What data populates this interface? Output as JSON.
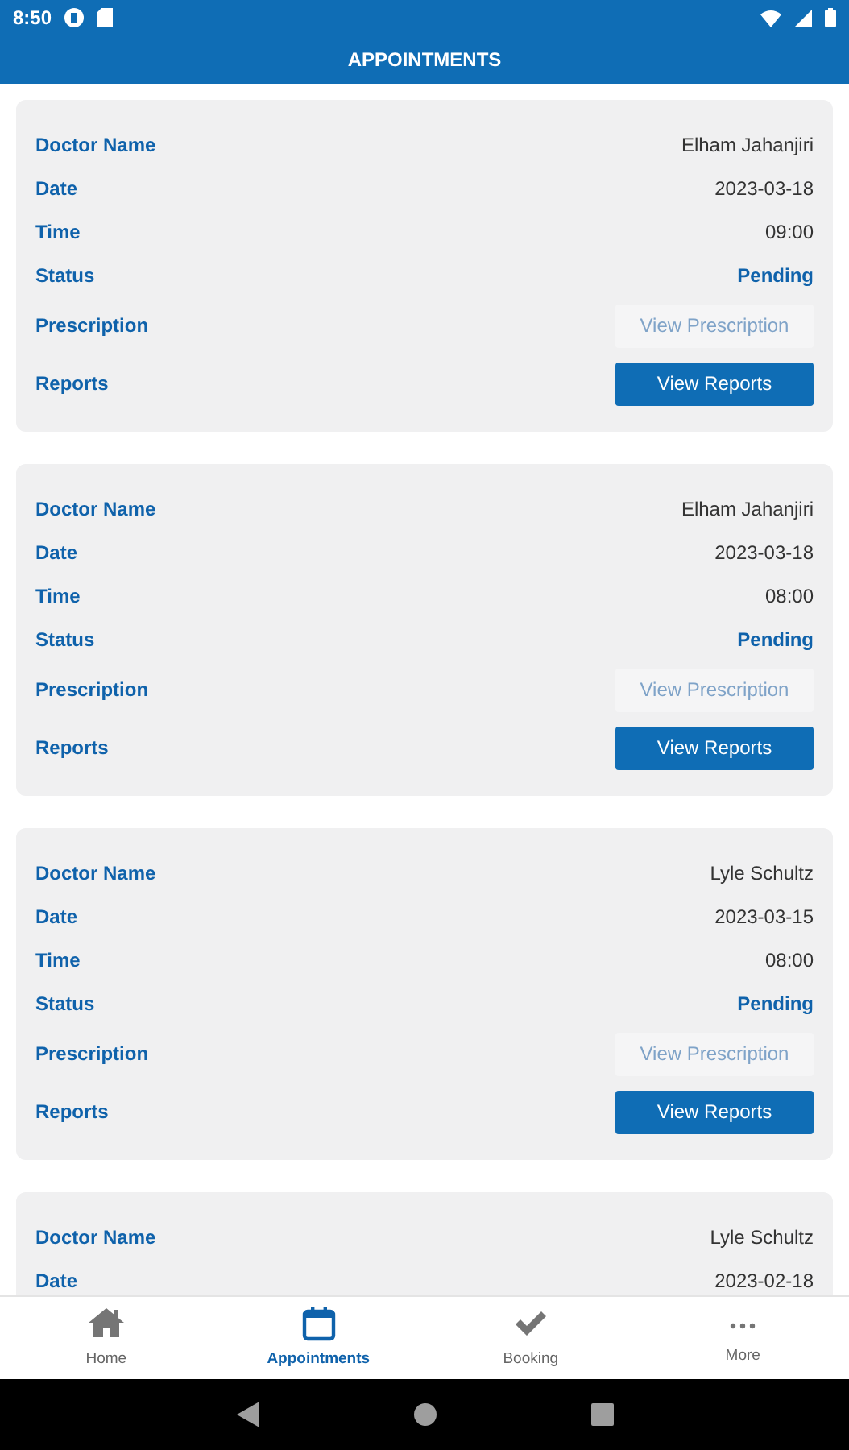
{
  "status_bar": {
    "time": "8:50"
  },
  "header": {
    "title": "APPOINTMENTS"
  },
  "appointments": [
    {
      "fields": [
        {
          "label": "Doctor Name",
          "kind": "text",
          "value": "Elham Jahanjiri"
        },
        {
          "label": "Date",
          "kind": "text",
          "value": "2023-03-18"
        },
        {
          "label": "Time",
          "kind": "text",
          "value": "09:00"
        },
        {
          "label": "Status",
          "kind": "status",
          "value": "Pending"
        },
        {
          "label": "Prescription",
          "kind": "button",
          "value": "View Prescription",
          "disabled": true
        },
        {
          "label": "Reports",
          "kind": "button",
          "value": "View Reports",
          "disabled": false
        }
      ]
    },
    {
      "fields": [
        {
          "label": "Doctor Name",
          "kind": "text",
          "value": "Elham Jahanjiri"
        },
        {
          "label": "Date",
          "kind": "text",
          "value": "2023-03-18"
        },
        {
          "label": "Time",
          "kind": "text",
          "value": "08:00"
        },
        {
          "label": "Status",
          "kind": "status",
          "value": "Pending"
        },
        {
          "label": "Prescription",
          "kind": "button",
          "value": "View Prescription",
          "disabled": true
        },
        {
          "label": "Reports",
          "kind": "button",
          "value": "View Reports",
          "disabled": false
        }
      ]
    },
    {
      "fields": [
        {
          "label": "Doctor Name",
          "kind": "text",
          "value": "Lyle Schultz"
        },
        {
          "label": "Date",
          "kind": "text",
          "value": "2023-03-15"
        },
        {
          "label": "Time",
          "kind": "text",
          "value": "08:00"
        },
        {
          "label": "Status",
          "kind": "status",
          "value": "Pending"
        },
        {
          "label": "Prescription",
          "kind": "button",
          "value": "View Prescription",
          "disabled": true
        },
        {
          "label": "Reports",
          "kind": "button",
          "value": "View Reports",
          "disabled": false
        }
      ]
    },
    {
      "fields": [
        {
          "label": "Doctor Name",
          "kind": "text",
          "value": "Lyle Schultz"
        },
        {
          "label": "Date",
          "kind": "text",
          "value": "2023-02-18"
        }
      ]
    }
  ],
  "tab_bar": [
    {
      "label": "Home",
      "selected": false
    },
    {
      "label": "Appointments",
      "selected": true
    },
    {
      "label": "Booking",
      "selected": false
    },
    {
      "label": "More",
      "selected": false
    }
  ]
}
